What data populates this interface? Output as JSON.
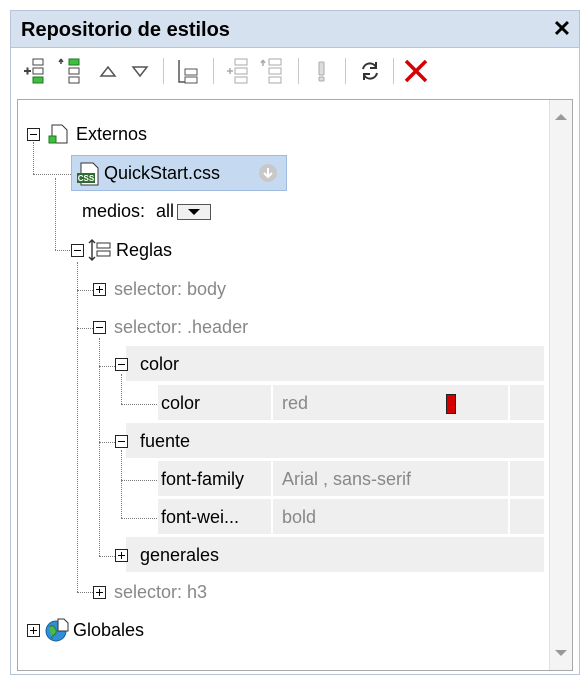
{
  "panel": {
    "title": "Repositorio de estilos",
    "close_label": "✕"
  },
  "toolbar": {
    "buttons": [
      {
        "name": "add-button"
      },
      {
        "name": "insert-button"
      },
      {
        "name": "move-up-button"
      },
      {
        "name": "move-down-button"
      },
      {
        "name": "add-rule-button"
      },
      {
        "name": "add-rule-child-button"
      },
      {
        "name": "insert-rule-button"
      },
      {
        "name": "important-button"
      },
      {
        "name": "reload-button"
      },
      {
        "name": "delete-button"
      }
    ]
  },
  "tree": {
    "externos": "Externos",
    "file": "QuickStart.css",
    "medios_label": "medios:",
    "medios_value": "all",
    "reglas": "Reglas",
    "selector_body": "selector: body",
    "selector_header": "selector: .header",
    "group_color": "color",
    "prop_color_name": "color",
    "prop_color_value": "red",
    "group_fuente": "fuente",
    "prop_ff_name": "font-family",
    "prop_ff_value": "Arial , sans-serif",
    "prop_fw_name": "font-wei...",
    "prop_fw_value": "bold",
    "group_generales": "generales",
    "selector_h3": "selector: h3",
    "globales": "Globales"
  },
  "colors": {
    "accent_selection": "#c5daf1",
    "swatch_red": "#d40000",
    "delete_red": "#d60000"
  }
}
